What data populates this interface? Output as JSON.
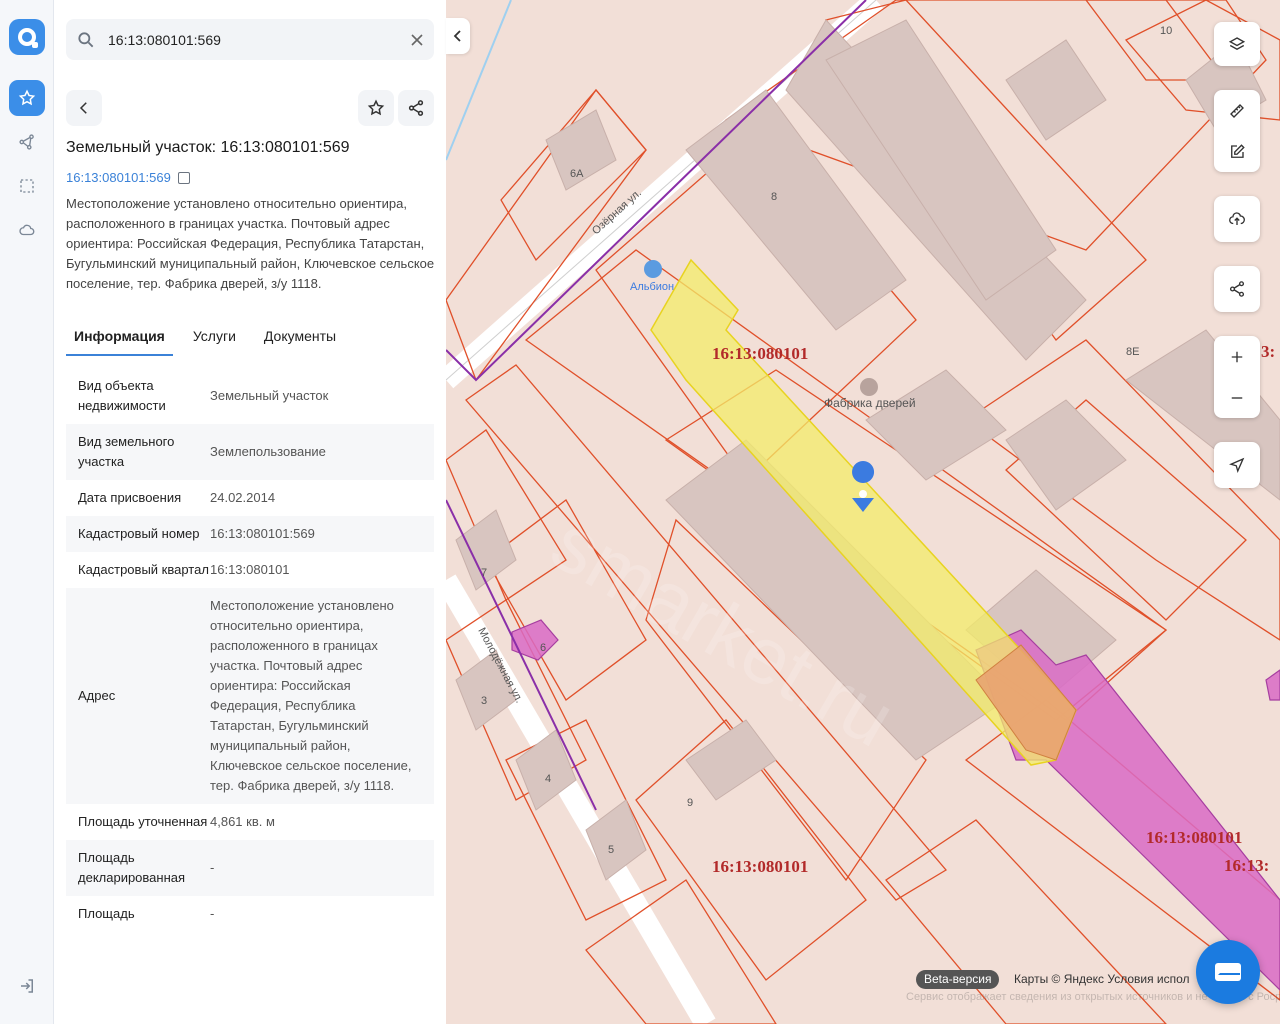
{
  "search": {
    "value": "16:13:080101:569"
  },
  "card": {
    "title": "Земельный участок: 16:13:080101:569",
    "cad_link": "16:13:080101:569",
    "description": "Местоположение установлено относительно ориентира, расположенного в границах участка. Почтовый адрес ориентира: Российская Федерация, Республика Татарстан, Бугульминский муниципальный район, Ключевское сельское поселение, тер. Фабрика дверей, з/у 1118."
  },
  "tabs": [
    {
      "label": "Информация"
    },
    {
      "label": "Услуги"
    },
    {
      "label": "Документы"
    }
  ],
  "info": [
    {
      "key": "Вид объекта недвижимости",
      "value": "Земельный участок"
    },
    {
      "key": "Вид земельного участка",
      "value": "Землепользование"
    },
    {
      "key": "Дата присвоения",
      "value": "24.02.2014"
    },
    {
      "key": "Кадастровый номер",
      "value": "16:13:080101:569"
    },
    {
      "key": "Кадастровый квартал",
      "value": "16:13:080101"
    },
    {
      "key": "Адрес",
      "value": "Местоположение установлено относительно ориентира, расположенного в границах участка. Почтовый адрес ориентира: Российская Федерация, Республика Татарстан, Бугульминский муниципальный район, Ключевское сельское поселение, тер. Фабрика дверей, з/у 1118."
    },
    {
      "key": "Площадь уточненная",
      "value": "4,861 кв. м"
    },
    {
      "key": "Площадь декларированная",
      "value": "-"
    },
    {
      "key": "Площадь",
      "value": "-"
    }
  ],
  "map": {
    "labels": {
      "quarter1": "16:13:080101",
      "quarter2": "16:13:080101",
      "quarter3": "16:13:080101",
      "quarter4": "16:13:",
      "quarter5": "3:",
      "street1": "Озёрная ул.",
      "street2": "Молодёжная ул.",
      "poi1": "Альбион",
      "poi2": "Фабрика дверей",
      "watermark": "smarket.ru",
      "b_6a": "6А",
      "b_8": "8",
      "b_8e": "8Е",
      "b_10": "10",
      "b_7": "7",
      "b_6": "6",
      "b_3": "3",
      "b_4": "4",
      "b_5": "5",
      "b_9": "9"
    },
    "beta": "Beta-версия",
    "copyright": "Карты © Яндекс   Условия испол",
    "disclaimer": "Сервис отображает сведения из открытых источников и не связан с Росреестром. Вся информация носит справочный характер и не является юридически значимой. За юридически значимыми сведениями обращайтесь в Росреестр."
  },
  "colors": {
    "accent": "#3b8ee8",
    "parcel_selected": "#f3ec6a",
    "parcel_border": "#e0502a",
    "parcel_magenta": "#d96bc6"
  }
}
